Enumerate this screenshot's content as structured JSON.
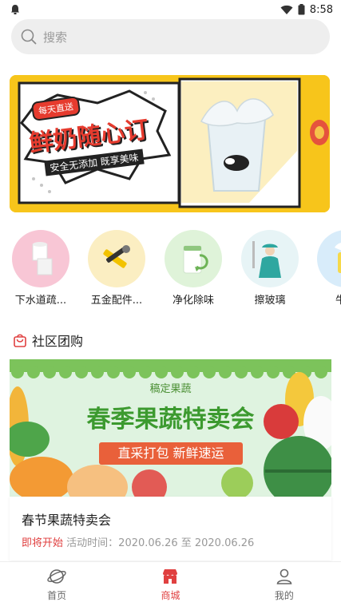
{
  "status_bar": {
    "time": "8:58",
    "icons": [
      "notification-icon",
      "wifi-icon",
      "battery-icon"
    ]
  },
  "search": {
    "placeholder": "搜索",
    "icon": "search-icon"
  },
  "banner": {
    "tag": "每天直送",
    "headline": "鲜奶随心订",
    "subline": "安全无添加 既享美味",
    "colors": {
      "background": "#f7c51b",
      "accent": "#e63b2e"
    }
  },
  "categories": [
    {
      "label": "下水道疏...",
      "icon": "pipe-icon"
    },
    {
      "label": "五金配件...",
      "icon": "hardware-tools-icon"
    },
    {
      "label": "净化除味",
      "icon": "air-purifier-icon"
    },
    {
      "label": "擦玻璃",
      "icon": "window-cleaner-icon"
    },
    {
      "label": "牛奶",
      "icon": "milk-icon"
    }
  ],
  "section": {
    "title": "社区团购",
    "icon": "shopping-bag-icon"
  },
  "promo": {
    "small_label": "稿定果蔬",
    "headline": "春季果蔬特卖会",
    "subline": "直采打包 新鲜速运"
  },
  "card": {
    "title": "春节果蔬特卖会",
    "status": "即将开始",
    "time_label": "活动时间：",
    "time_value": "2020.06.26 至 2020.06.26"
  },
  "bottom_nav": [
    {
      "label": "首页",
      "icon": "planet-icon",
      "active": false
    },
    {
      "label": "商城",
      "icon": "store-icon",
      "active": true
    },
    {
      "label": "我的",
      "icon": "user-icon",
      "active": false
    }
  ],
  "colors": {
    "primary": "#e04040",
    "text": "#222222",
    "muted": "#999999"
  }
}
